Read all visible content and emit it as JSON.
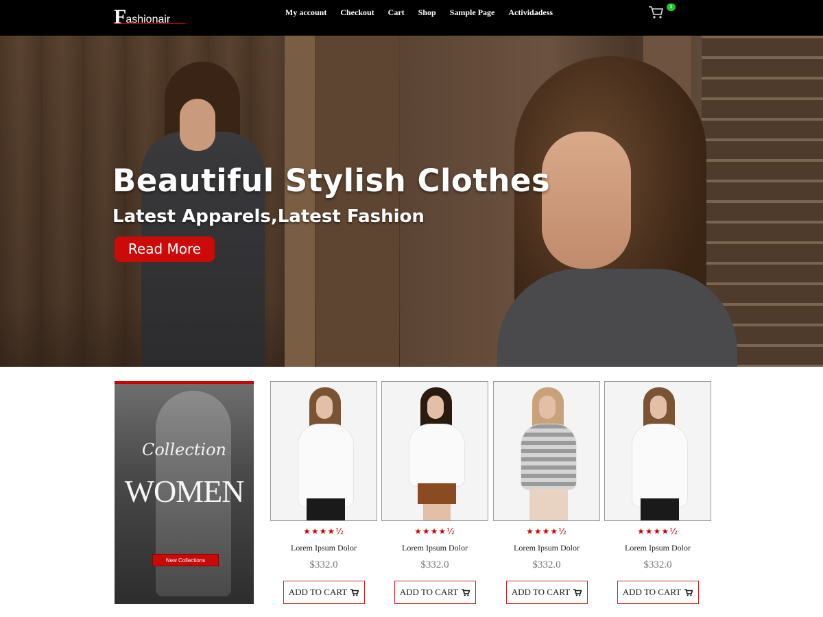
{
  "header": {
    "logo_initial": "F",
    "logo_rest": "ashionair",
    "nav": [
      "My account",
      "Checkout",
      "Cart",
      "Shop",
      "Sample Page",
      "Actividadess"
    ],
    "cart_count": "1",
    "cart_icon": "shopping-cart-icon"
  },
  "hero": {
    "title": "Beautiful Stylish Clothes",
    "subtitle": "Latest Apparels,Latest Fashion",
    "button_label": "Read More"
  },
  "collection": {
    "script_text": "Collection",
    "title": "WOMEN",
    "button_label": "New Collections"
  },
  "products": [
    {
      "name": "Lorem Ipsum Dolor",
      "price": "$332.0",
      "rating": 4.5,
      "button_label": "ADD TO CART",
      "bottom_color": "#1a1a1a",
      "top_color": "#fafafa"
    },
    {
      "name": "Lorem Ipsum Dolor",
      "price": "$332.0",
      "rating": 4.5,
      "button_label": "ADD TO CART",
      "bottom_color": "#8a4a22",
      "top_color": "#fafafa"
    },
    {
      "name": "Lorem Ipsum Dolor",
      "price": "$332.0",
      "rating": 4.5,
      "button_label": "ADD TO CART",
      "bottom_color": "#e8d2c2",
      "top_color": "#a8a8a8"
    },
    {
      "name": "Lorem Ipsum Dolor",
      "price": "$332.0",
      "rating": 4.5,
      "button_label": "ADD TO CART",
      "bottom_color": "#1a1a1a",
      "top_color": "#fafafa"
    }
  ],
  "colors": {
    "accent": "#cc0a0a",
    "header_bg": "#000000",
    "badge": "#21c52a",
    "star": "#cc0000"
  }
}
